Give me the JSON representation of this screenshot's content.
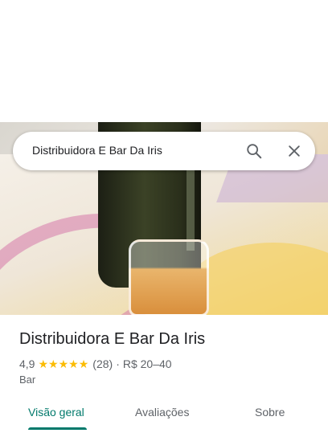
{
  "search": {
    "query": "Distribuidora E Bar Da Iris",
    "search_icon": "search-icon",
    "close_icon": "close-icon"
  },
  "place": {
    "name": "Distribuidora E Bar Da Iris",
    "rating": "4,9",
    "stars": 5,
    "reviews": "(28)",
    "separator": "·",
    "price": "R$ 20–40",
    "category": "Bar"
  },
  "tabs": [
    {
      "label": "Visão geral",
      "active": true
    },
    {
      "label": "Avaliações",
      "active": false
    },
    {
      "label": "Sobre",
      "active": false
    }
  ],
  "colors": {
    "accent": "#00796b",
    "star": "#fbbc04",
    "text_secondary": "#5f6368"
  }
}
